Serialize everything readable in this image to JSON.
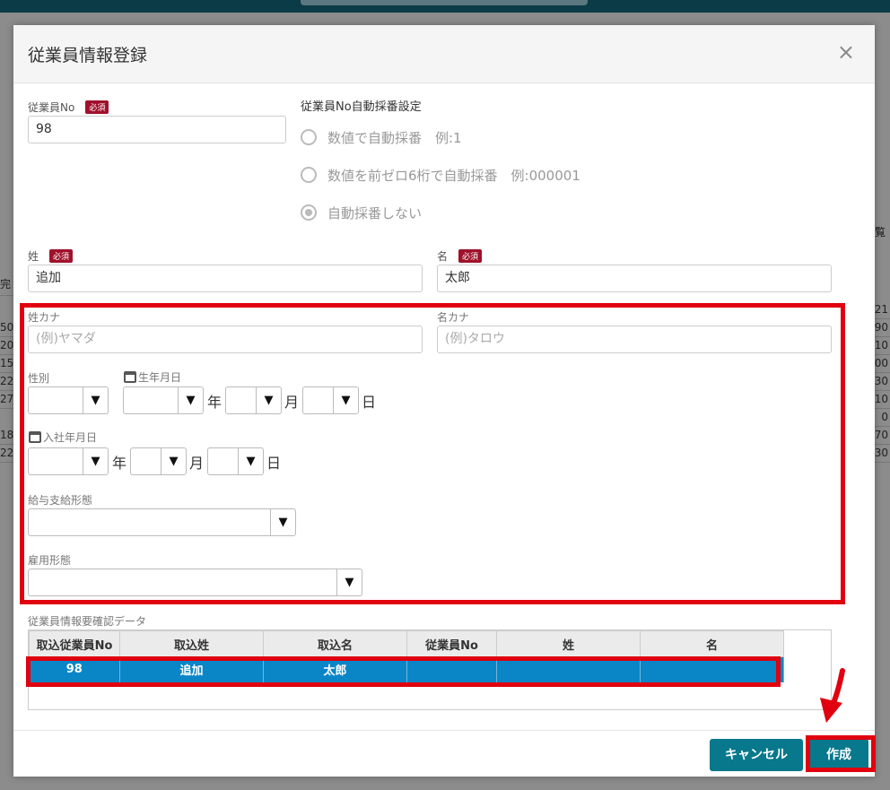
{
  "background": {
    "fragment_top_right": "覧",
    "fragment_left": "完",
    "right_column_values": [
      "21",
      "90",
      "10",
      "00",
      "30",
      "10",
      "0",
      "70",
      "30"
    ],
    "left_column_values": [
      "50",
      "20",
      "15",
      "22",
      "27",
      "",
      "18",
      "22"
    ]
  },
  "dialog": {
    "title": "従業員情報登録",
    "close_label": "×"
  },
  "fields": {
    "required_badge": "必須",
    "employee_no": {
      "label": "従業員No",
      "value": "98"
    },
    "auto_numbering": {
      "title": "従業員No自動採番設定",
      "options": [
        {
          "label": "数値で自動採番　例:1",
          "checked": false
        },
        {
          "label": "数値を前ゼロ6桁で自動採番　例:000001",
          "checked": false
        },
        {
          "label": "自動採番しない",
          "checked": true
        }
      ]
    },
    "last_name": {
      "label": "姓",
      "value": "追加"
    },
    "first_name": {
      "label": "名",
      "value": "太郎"
    },
    "last_name_kana": {
      "label": "姓カナ",
      "placeholder": "(例)ヤマダ"
    },
    "first_name_kana": {
      "label": "名カナ",
      "placeholder": "(例)タロウ"
    },
    "gender": {
      "label": "性別"
    },
    "birth_date": {
      "label": "生年月日"
    },
    "hire_date": {
      "label": "入社年月日"
    },
    "pay_type": {
      "label": "給与支給形態"
    },
    "employment_type": {
      "label": "雇用形態"
    },
    "units": {
      "year": "年",
      "month": "月",
      "day": "日"
    },
    "select_arrow": "▼"
  },
  "confirm_table": {
    "title": "従業員情報要確認データ",
    "headers": [
      "取込従業員No",
      "取込姓",
      "取込名",
      "従業員No",
      "姓",
      "名"
    ],
    "rows": [
      [
        "98",
        "追加",
        "太郎",
        "",
        "",
        ""
      ]
    ]
  },
  "footer": {
    "cancel_label": "キャンセル",
    "create_label": "作成"
  },
  "colors": {
    "primary": "#08788c",
    "highlight": "#e0000f",
    "selected_row": "#0a86c6",
    "required_badge": "#a0112b"
  }
}
